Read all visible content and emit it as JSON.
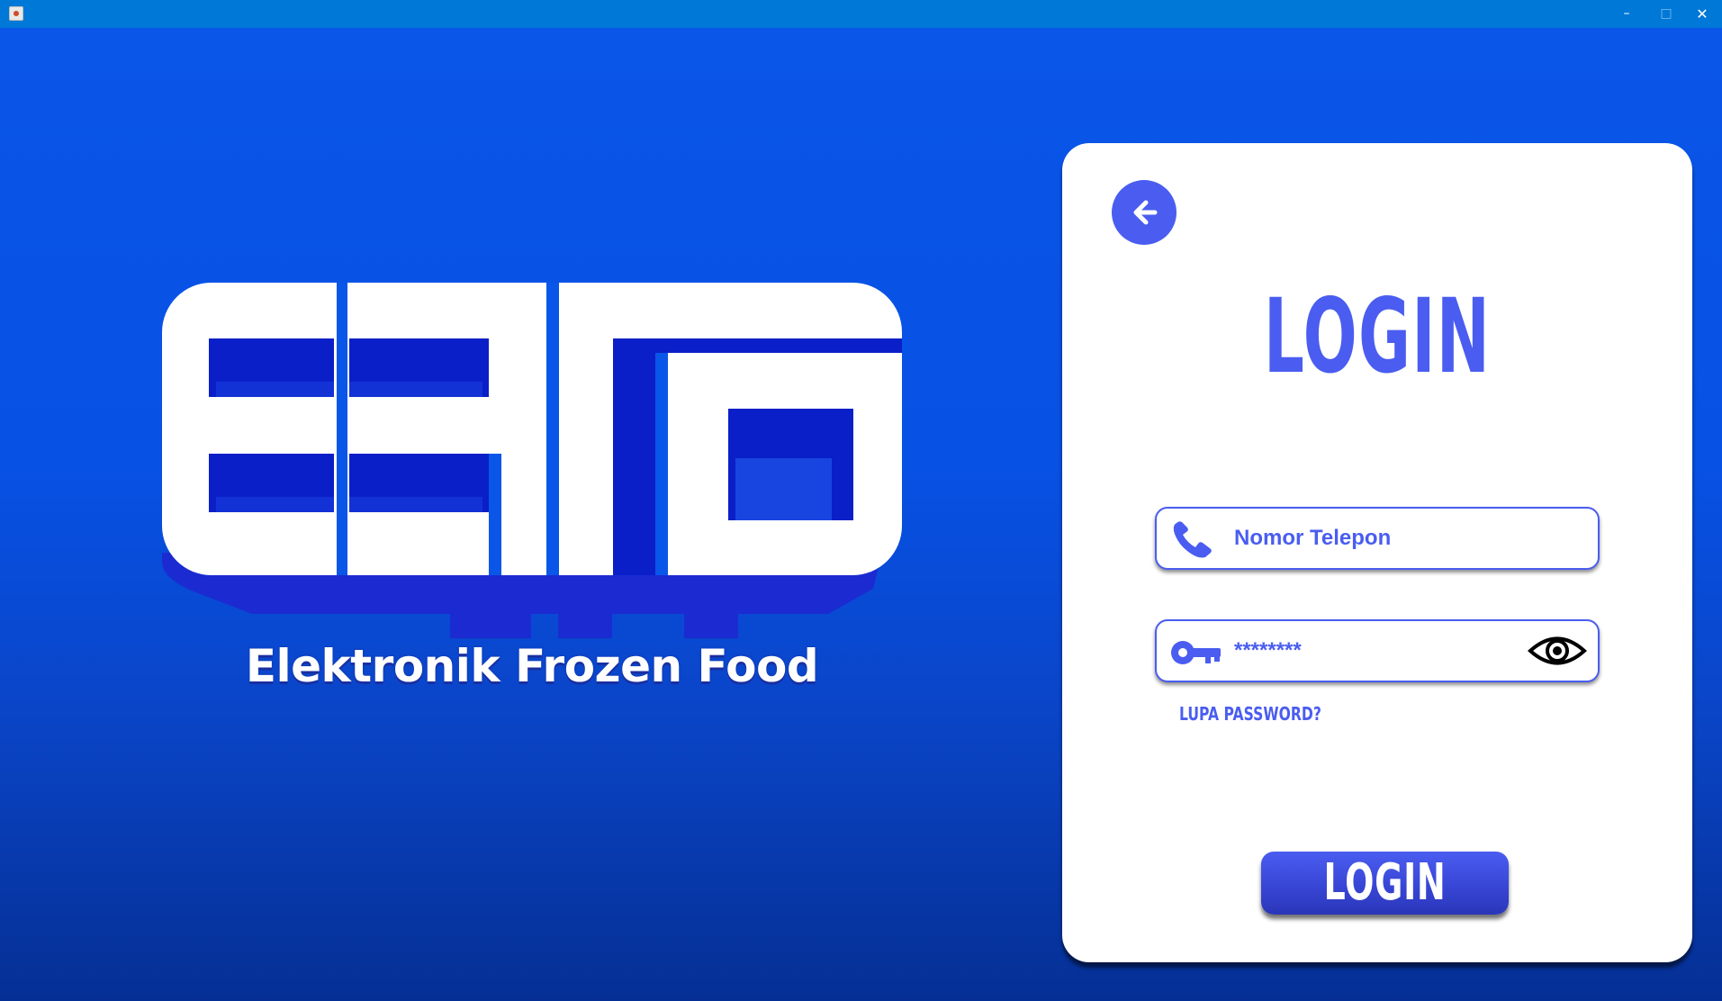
{
  "window": {
    "title": "",
    "controls": {
      "minimize": "–",
      "maximize": "□",
      "close": "✕"
    }
  },
  "brand": {
    "logo_icon": "ebfo-logo",
    "tagline": "Elektronik Frozen Food"
  },
  "login": {
    "back_icon": "arrow-left-icon",
    "title": "LOGIN",
    "phone": {
      "placeholder": "Nomor Telepon",
      "value": "",
      "icon": "phone-icon"
    },
    "password": {
      "placeholder": "",
      "value": "********",
      "icon": "key-icon",
      "toggle_icon": "eye-icon"
    },
    "forgot": "LUPA PASSWORD?",
    "submit": "LOGIN"
  },
  "colors": {
    "accent": "#4a5df0",
    "background_top": "#0a56e8",
    "background_bottom": "#052f94",
    "titlebar": "#0078d7",
    "card": "#ffffff"
  }
}
